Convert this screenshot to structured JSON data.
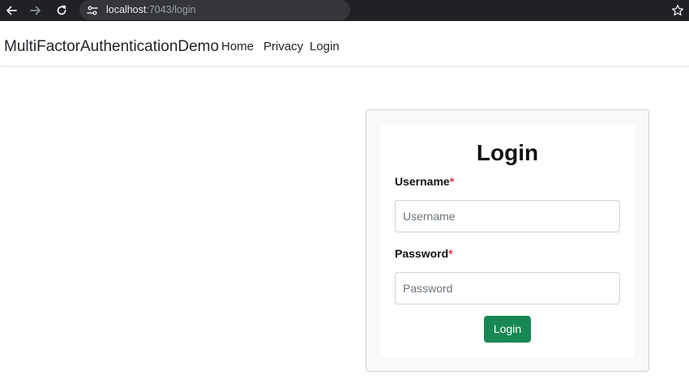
{
  "browser": {
    "url_host": "localhost",
    "url_path": ":7043/login",
    "icons": [
      "back-arrow-icon",
      "forward-arrow-icon",
      "reload-icon",
      "site-info-icon",
      "bookmark-star-icon"
    ]
  },
  "navbar": {
    "brand": "MultiFactorAuthenticationDemo",
    "links": [
      "Home",
      "Privacy",
      "Login"
    ]
  },
  "login_form": {
    "title": "Login",
    "username_label": "Username",
    "username_placeholder": "Username",
    "username_value": "",
    "password_label": "Password",
    "password_placeholder": "Password",
    "password_value": "",
    "required_marker": "*",
    "submit_label": "Login"
  },
  "colors": {
    "browser_bar": "#202124",
    "omnibox": "#35363a",
    "required": "#dc3545",
    "submit_button": "#198754",
    "card_background": "#f8f9fa"
  }
}
